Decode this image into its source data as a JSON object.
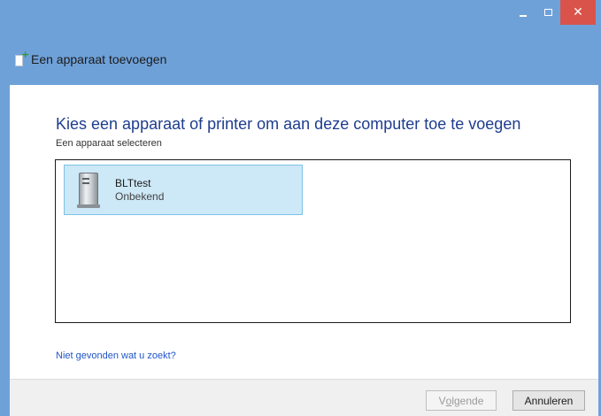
{
  "window": {
    "caption_buttons": {
      "minimize_icon": "minimize-icon",
      "maximize_icon": "maximize-icon",
      "close_glyph": "✕"
    }
  },
  "dialog": {
    "title": "Een apparaat toevoegen",
    "heading": "Kies een apparaat of printer om aan deze computer toe te voegen",
    "subheading": "Een apparaat selecteren",
    "devices": [
      {
        "name": "BLTtest",
        "status": "Onbekend",
        "icon": "computer-tower-icon"
      }
    ],
    "not_found_link": "Niet gevonden wat u zoekt?",
    "buttons": {
      "next_prefix": "V",
      "next_accel": "o",
      "next_suffix": "lgende",
      "cancel": "Annuleren"
    }
  },
  "colors": {
    "title_bar": "#6fa1d9",
    "heading": "#1e3d8f",
    "link": "#1f54c7",
    "selection": "#cde8f6",
    "close_button": "#d9534b"
  }
}
